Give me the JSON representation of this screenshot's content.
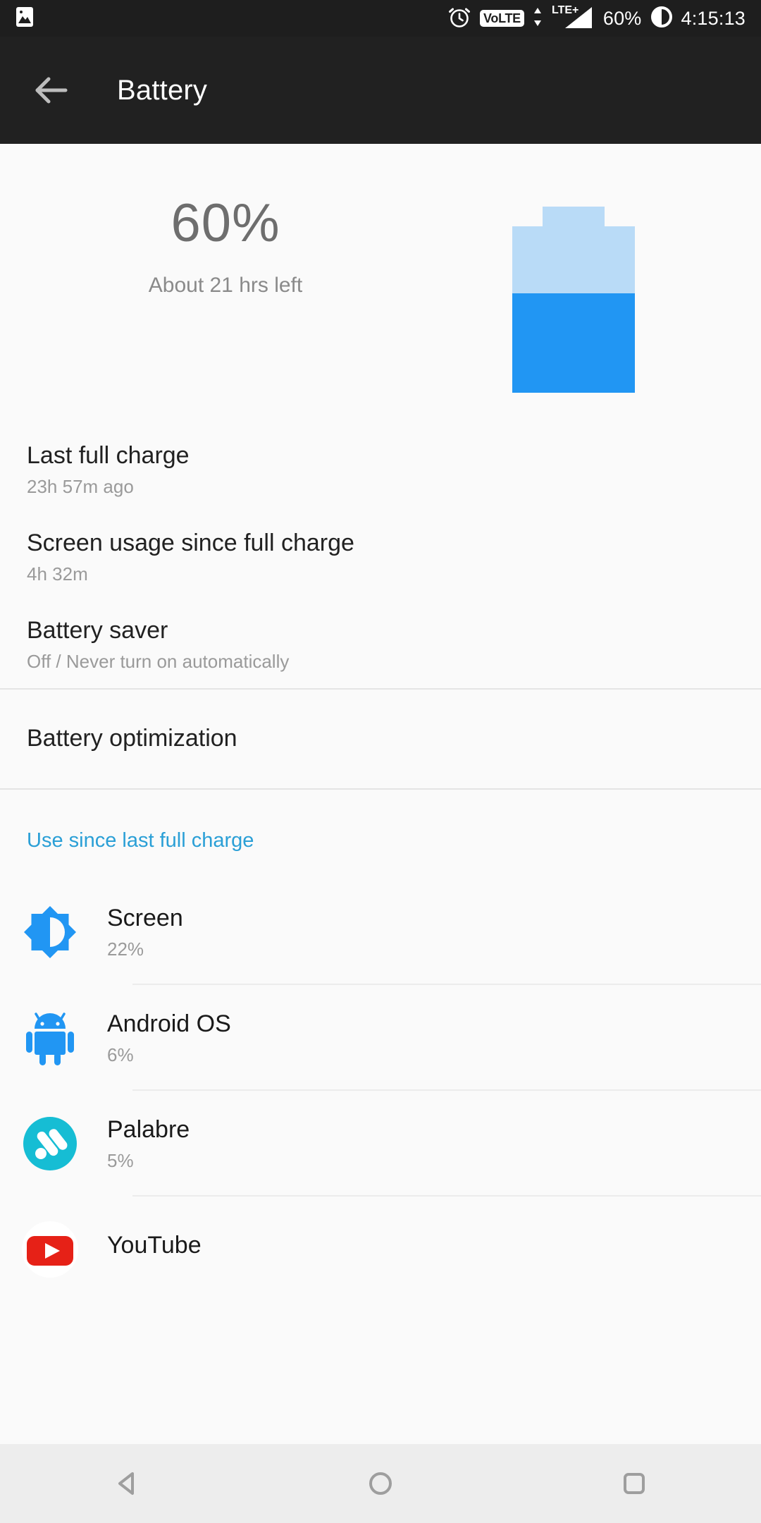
{
  "status_bar": {
    "left_icons": [
      {
        "name": "image-icon",
        "glyph": "image"
      }
    ],
    "alarm_icon": "alarm-clock-icon",
    "volte_label": "VoLTE",
    "network_label": "LTE+",
    "battery_percent": "60%",
    "battery_icon": "dnd-circle-icon",
    "time": "4:15:13"
  },
  "app_bar": {
    "back_icon": "back-arrow-icon",
    "title": "Battery"
  },
  "summary": {
    "percent": "60%",
    "time_left": "About 21 hrs left",
    "battery_level": 60,
    "fill_color": "#2196f3",
    "empty_color": "#b9dbf7"
  },
  "settings_rows": [
    {
      "title": "Last full charge",
      "subtitle": "23h 57m ago"
    },
    {
      "title": "Screen usage since full charge",
      "subtitle": "4h 32m"
    },
    {
      "title": "Battery saver",
      "subtitle": "Off / Never turn on automatically"
    }
  ],
  "optimization": {
    "title": "Battery optimization"
  },
  "usage_section": {
    "link_label": "Use since last full charge",
    "link_color": "#2a9fd6"
  },
  "apps": [
    {
      "name": "Screen",
      "percent": "22%",
      "icon": "brightness-icon",
      "color": "#2196f3"
    },
    {
      "name": "Android OS",
      "percent": "6%",
      "icon": "android-robot-icon",
      "color": "#2196f3"
    },
    {
      "name": "Palabre",
      "percent": "5%",
      "icon": "palabre-rss-icon",
      "color": "#16bdd4"
    },
    {
      "name": "YouTube",
      "percent": "",
      "icon": "youtube-icon",
      "color": "#e62117"
    }
  ],
  "nav_bar": {
    "back": "nav-back-icon",
    "home": "nav-home-icon",
    "recents": "nav-recents-icon"
  }
}
